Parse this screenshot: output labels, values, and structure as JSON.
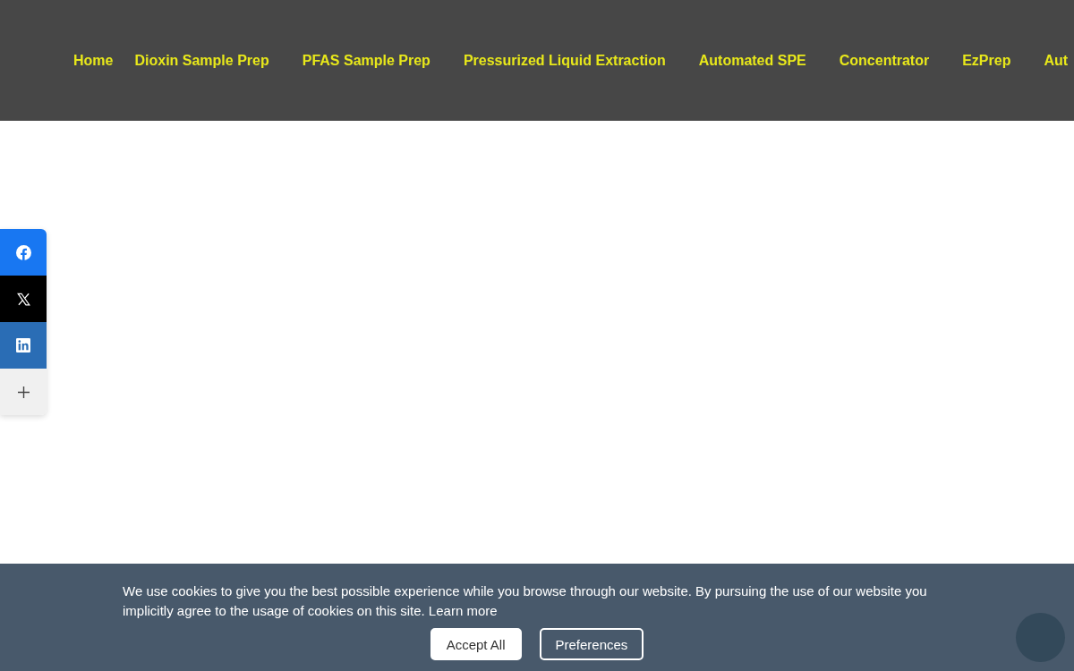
{
  "nav": {
    "items": [
      {
        "label": "Home"
      },
      {
        "label": "Dioxin Sample Prep"
      },
      {
        "label": "PFAS Sample Prep"
      },
      {
        "label": "Pressurized Liquid Extraction"
      },
      {
        "label": "Automated SPE"
      },
      {
        "label": "Concentrator"
      },
      {
        "label": "EzPrep"
      },
      {
        "label": "Aut"
      }
    ]
  },
  "share_bar": {
    "items": [
      {
        "kind": "facebook",
        "color": "#1877f2"
      },
      {
        "kind": "x",
        "color": "#000000"
      },
      {
        "kind": "linkedin",
        "color": "#2a6db5"
      },
      {
        "kind": "more",
        "color": "#f0f0f0"
      }
    ]
  },
  "cookie_banner": {
    "text": "We use cookies to give you the best possible experience while you browse through our website. By pursuing the use of our website you implicitly agree to the usage of cookies on this site.",
    "link": "Learn more",
    "buttons": [
      {
        "label": "Accept All",
        "kind": "primary"
      },
      {
        "label": "Preferences",
        "kind": "outline"
      }
    ]
  }
}
